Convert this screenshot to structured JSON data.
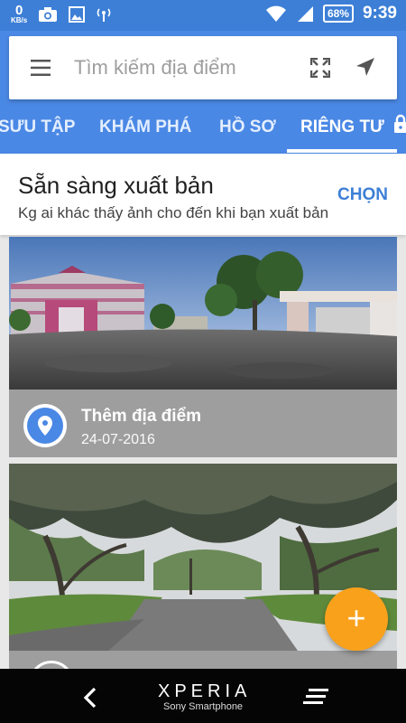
{
  "status": {
    "kbs_value": "0",
    "kbs_unit": "KB/s",
    "battery": "68%",
    "time": "9:39"
  },
  "search": {
    "placeholder": "Tìm kiếm địa điểm"
  },
  "tabs": [
    {
      "label": "SƯU TẬP"
    },
    {
      "label": "KHÁM PHÁ"
    },
    {
      "label": "HỒ SƠ"
    },
    {
      "label": "RIÊNG TƯ"
    }
  ],
  "publish": {
    "title": "Sẵn sàng xuất bản",
    "subtitle": "Kg ai khác thấy ảnh cho đến khi bạn xuất bản",
    "select_label": "CHỌN"
  },
  "photos": [
    {
      "title": "Thêm địa điểm",
      "date": "24-07-2016"
    }
  ],
  "fab": {
    "label": "+"
  },
  "navbar": {
    "brand": "XPERIA",
    "brand_sub": "Sony Smartphone"
  },
  "colors": {
    "primary": "#4a88e5",
    "status_bar": "#3d7fd6",
    "accent": "#f9a11b",
    "card_gray": "#9e9e9e"
  }
}
